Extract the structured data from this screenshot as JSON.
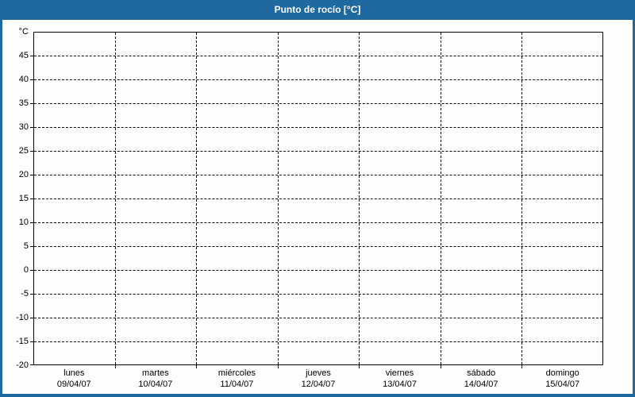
{
  "window": {
    "title": "Punto de rocío [°C]",
    "accent_color": "#1e69a0",
    "content_background": "#fdfefb",
    "grid_color": "#000000",
    "title_text_color": "#ffffff"
  },
  "chart_data": {
    "type": "line",
    "title": "Punto de rocío [°C]",
    "y_unit_label": "°C",
    "ylim": [
      -20,
      50
    ],
    "ytick_step": 5,
    "yticks": [
      45,
      40,
      35,
      30,
      25,
      20,
      15,
      10,
      5,
      0,
      -5,
      -10,
      -15,
      -20
    ],
    "x_categories": [
      {
        "day": "lunes",
        "date": "09/04/07"
      },
      {
        "day": "martes",
        "date": "10/04/07"
      },
      {
        "day": "miércoles",
        "date": "11/04/07"
      },
      {
        "day": "jueves",
        "date": "12/04/07"
      },
      {
        "day": "viernes",
        "date": "13/04/07"
      },
      {
        "day": "sábado",
        "date": "14/04/07"
      },
      {
        "day": "domingo",
        "date": "15/04/07"
      }
    ],
    "series": [],
    "grid": "dashed",
    "legend": "none"
  }
}
